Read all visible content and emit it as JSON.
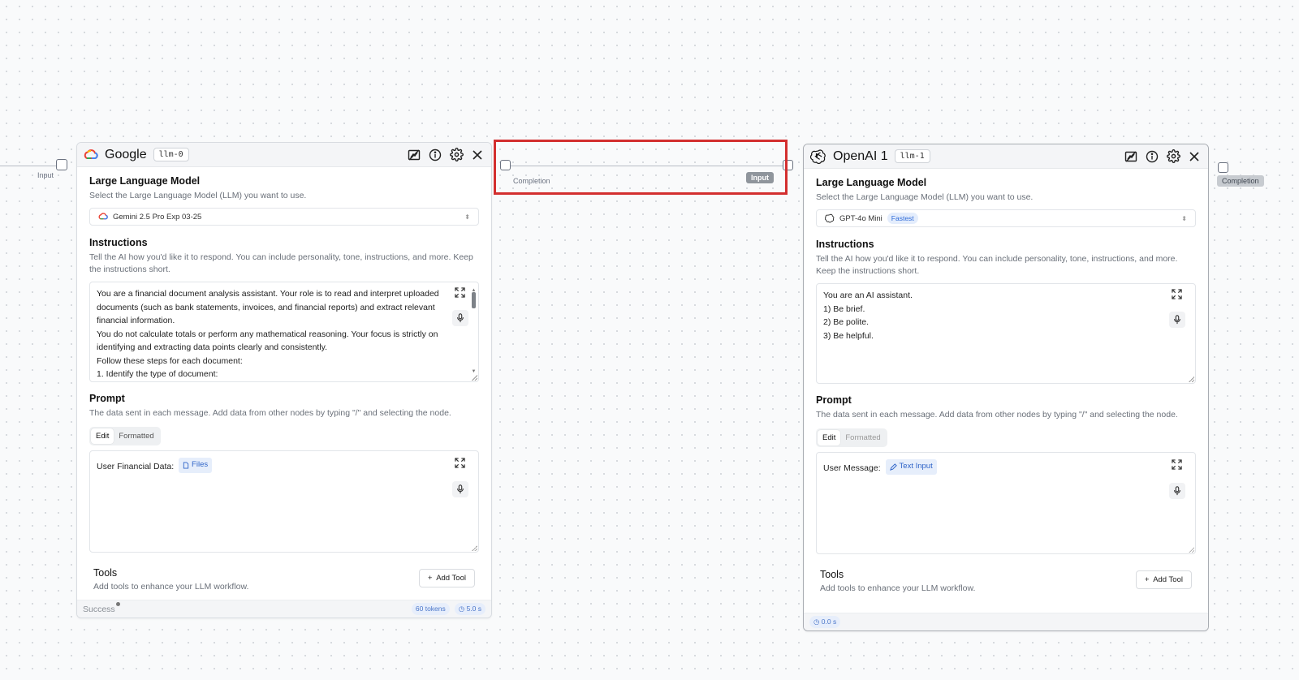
{
  "left_edge": {
    "tag": "Input"
  },
  "google_node": {
    "title": "Google",
    "id": "llm-0",
    "llm_section": {
      "title": "Large Language Model",
      "desc": "Select the Large Language Model (LLM) you want to use."
    },
    "model": {
      "value": "Gemini 2.5 Pro Exp 03-25"
    },
    "instructions": {
      "title": "Instructions",
      "desc": "Tell the AI how you'd like it to respond. You can include personality, tone, instructions, and more. Keep the instructions short.",
      "lines": [
        "You are a financial document analysis assistant. Your role is to read and interpret uploaded",
        "documents (such as bank statements, invoices, and financial reports) and extract relevant",
        "financial information.",
        "You do not calculate totals or perform any mathematical reasoning. Your focus is strictly on",
        "identifying and extracting data points clearly and consistently.",
        "Follow these steps for each document:",
        "1. Identify the type of document:"
      ]
    },
    "prompt": {
      "title": "Prompt",
      "desc": "The data sent in each message. Add data from other nodes by typing \"/\" and selecting the node.",
      "tab_edit": "Edit",
      "tab_formatted": "Formatted",
      "text": "User Financial Data:",
      "chip": "Files"
    },
    "tools": {
      "title": "Tools",
      "desc": "Add tools to enhance your LLM workflow.",
      "button": "Add Tool"
    },
    "footer": {
      "status": "Success",
      "tokens": "60 tokens",
      "time": "5.0 s"
    },
    "colors": {
      "brand": "#ea4335"
    }
  },
  "edge_middle": {
    "left_tag": "Completion",
    "right_tag": "Input"
  },
  "openai_node": {
    "title": "OpenAI 1",
    "id": "llm-1",
    "llm_section": {
      "title": "Large Language Model",
      "desc": "Select the Large Language Model (LLM) you want to use."
    },
    "model": {
      "value": "GPT-4o Mini",
      "badge": "Fastest"
    },
    "instructions": {
      "title": "Instructions",
      "desc": "Tell the AI how you'd like it to respond. You can include personality, tone, instructions, and more. Keep the instructions short.",
      "lines": [
        "You are an AI assistant.",
        "1) Be brief.",
        "2) Be polite.",
        "3) Be helpful."
      ]
    },
    "prompt": {
      "title": "Prompt",
      "desc": "The data sent in each message. Add data from other nodes by typing \"/\" and selecting the node.",
      "tab_edit": "Edit",
      "tab_formatted": "Formatted",
      "text": "User Message:",
      "chip": "Text Input"
    },
    "tools": {
      "title": "Tools",
      "desc": "Add tools to enhance your LLM workflow.",
      "button": "Add Tool"
    },
    "footer": {
      "time": "0.0 s"
    }
  },
  "right_edge": {
    "tag": "Completion"
  },
  "highlight": {
    "color": "#d32f2f"
  }
}
